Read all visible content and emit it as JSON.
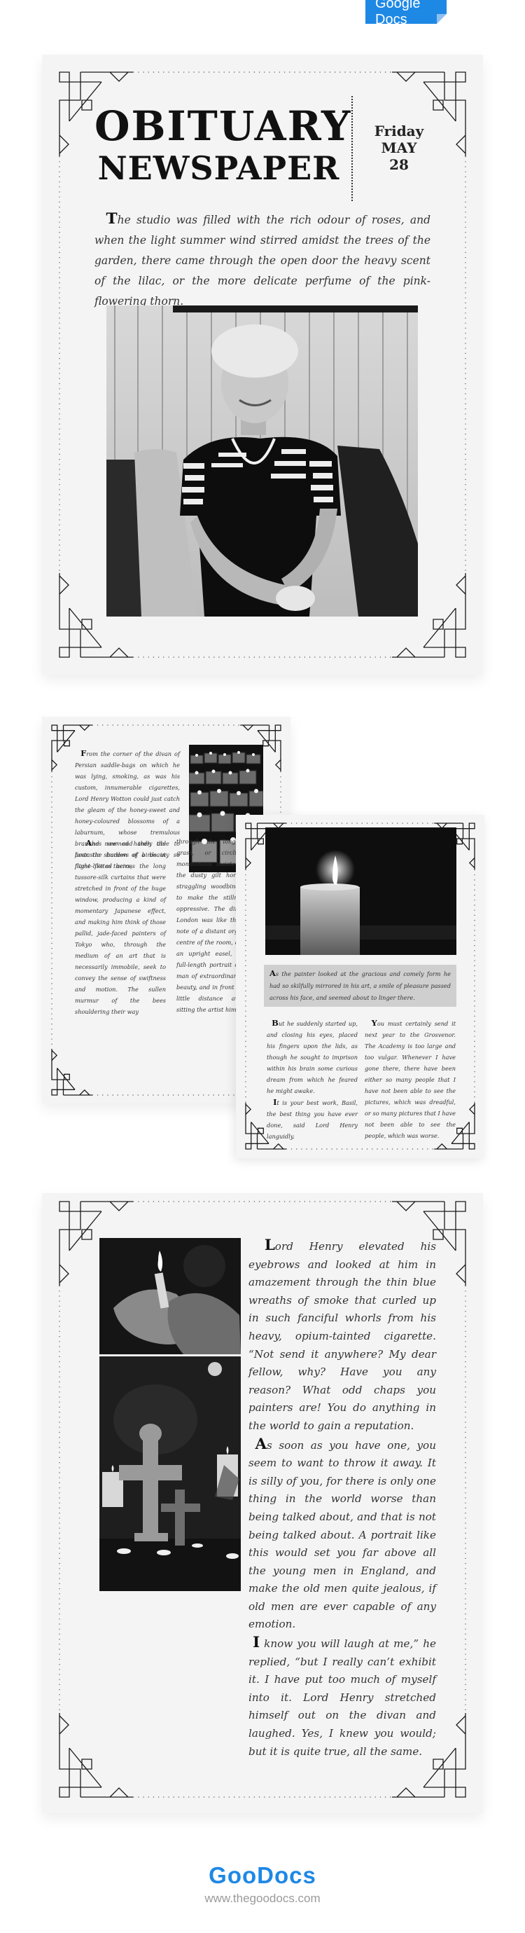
{
  "badge": {
    "label": "Google Docs"
  },
  "page1": {
    "title_line1": "OBITUARY",
    "title_line2": "NEWSPAPER",
    "date_day": "Friday",
    "date_month": "MAY",
    "date_num": "28",
    "intro_drop": "T",
    "intro_text": "he studio was filled with the rich odour of roses, and when the light summer wind stirred amidst the trees of the garden, there came through the open door the heavy scent of the lilac, or the more delicate perfume of the pink-flowering thorn.",
    "photo_alt": "Elderly woman smiling, seated in an armchair (black and white photo)"
  },
  "page2": {
    "p1_drop": "F",
    "p1_text": "rom the corner of the divan of Persian saddle-bags on which he was lying, smoking, as was his custom, innumerable cigarettes, Lord Henry Wotton could just catch the gleam of the honey-sweet and honey-coloured blossoms of a laburnum, whose tremulous branches seemed hardly able to bear the burden of a beauty so flame-like as theirs;",
    "photo_alt": "Rows of lit candles (black and white photo)",
    "col1_drop": "A",
    "col1_text": "nd now and then the fantastic shadows of birds in flight flitted across the long tussore-silk curtains that were stretched in front of the huge window, producing a kind of momentary Japanese effect, and making him think of those pallid, jade-faced painters of Tokyo who, through the medium of an art that is necessarily immobile, seek to convey the sense of swiftness and motion. The sullen murmur of the bees shouldering their way",
    "col2_text": "through the long unmown grass, or circling with monotonous insistence round the dusty gilt horns of the straggling woodbine, seemed to make the stillness more oppressive. The dim roar of London was like the bourdon note of a distant organ. In the centre of the room, clamped to an upright easel, stood the full-length portrait of a young man of extraordinary personal beauty, and in front of it, some little distance away, was sitting the artist himself."
  },
  "page3": {
    "photo_alt": "Single lit candle in the dark (black and white photo)",
    "highlight_drop": "A",
    "highlight_text": "s the painter looked at the gracious and comely form he had so skilfully mirrored in his art, a smile of pleasure passed across his face, and seemed about to linger there.",
    "col1_p1_drop": "B",
    "col1_p1_text": "ut he suddenly started up, and closing his eyes, placed his fingers upon the lids, as though he sought to imprison within his brain some curious dream from which he feared he might awake.",
    "col1_p2_drop": "I",
    "col1_p2_text": "t is your best work, Basil, the best thing you have ever done, said Lord Henry languidly.",
    "col2_drop": "Y",
    "col2_text": "ou must certainly send it next year to the Grosvenor. The Academy is too large and too vulgar. Whenever I have gone there, there have been either so many people that I have not been able to see the pictures, which was dreadful, or so many pictures that I have not been able to see the people, which was worse."
  },
  "page4": {
    "photo1_alt": "Hands holding a lit candle (black and white photo)",
    "photo2_alt": "Ornate crosses with candles on a table (black and white photo)",
    "p1_drop": "L",
    "p1_text": "ord Henry elevated his eyebrows and looked at him in amazement through the thin blue wreaths of smoke that curled up in such fanciful whorls from his heavy, opium-tainted cigarette. “Not send it anywhere? My dear fellow, why? Have you any reason? What odd chaps you painters are! You do anything in the world to gain a reputation.",
    "p2_drop": "A",
    "p2_text": "s soon as you have one, you seem to want to throw it away. It is silly of you, for there is only one thing in the world worse than being talked about, and that is not being talked about. A portrait like this would set you far above all the young men in England, and make the old men quite jealous, if old men are ever capable of any emotion.",
    "p3_drop": "I",
    "p3_text": " know you will laugh at me,” he replied, “but I really can’t exhibit it. I have put too much of myself into it. Lord Henry stretched himself out on the divan and laughed. Yes, I knew you would; but it is quite true, all the same."
  },
  "footer": {
    "logo": "GooDocs",
    "url": "www.thegoodocs.com"
  },
  "colors": {
    "brand_blue": "#1e88e5",
    "page_bg": "#f4f4f4",
    "highlight_bg": "#cfcfcf",
    "ink": "#111111"
  }
}
